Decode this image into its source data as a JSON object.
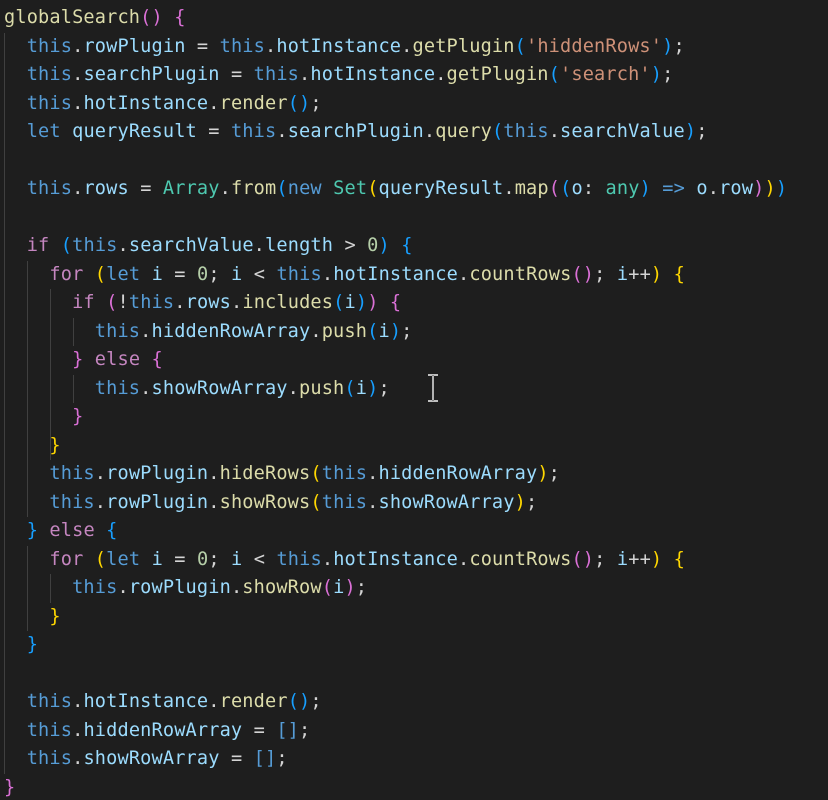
{
  "editor": {
    "colors": {
      "background": "#1e1e1e",
      "keyword": "#569cd6",
      "control": "#c586c0",
      "function": "#dcdcaa",
      "property": "#9cdcfe",
      "string": "#ce9178",
      "number": "#b5cea8",
      "type": "#4ec9b0",
      "bracket1": "#ffd700",
      "bracket2": "#da70d6",
      "bracket3": "#179fff"
    },
    "lines": [
      [
        [
          "fn",
          "globalSearch"
        ],
        [
          "b2",
          "()"
        ],
        [
          "plain",
          " "
        ],
        [
          "b2",
          "{"
        ]
      ],
      [
        [
          "plain",
          "  "
        ],
        [
          "kw",
          "this"
        ],
        [
          "plain",
          "."
        ],
        [
          "var",
          "rowPlugin"
        ],
        [
          "plain",
          " = "
        ],
        [
          "kw",
          "this"
        ],
        [
          "plain",
          "."
        ],
        [
          "var",
          "hotInstance"
        ],
        [
          "plain",
          "."
        ],
        [
          "fn",
          "getPlugin"
        ],
        [
          "b3",
          "("
        ],
        [
          "str",
          "'hiddenRows'"
        ],
        [
          "b3",
          ")"
        ],
        [
          "plain",
          ";"
        ]
      ],
      [
        [
          "plain",
          "  "
        ],
        [
          "kw",
          "this"
        ],
        [
          "plain",
          "."
        ],
        [
          "var",
          "searchPlugin"
        ],
        [
          "plain",
          " = "
        ],
        [
          "kw",
          "this"
        ],
        [
          "plain",
          "."
        ],
        [
          "var",
          "hotInstance"
        ],
        [
          "plain",
          "."
        ],
        [
          "fn",
          "getPlugin"
        ],
        [
          "b3",
          "("
        ],
        [
          "str",
          "'search'"
        ],
        [
          "b3",
          ")"
        ],
        [
          "plain",
          ";"
        ]
      ],
      [
        [
          "plain",
          "  "
        ],
        [
          "kw",
          "this"
        ],
        [
          "plain",
          "."
        ],
        [
          "var",
          "hotInstance"
        ],
        [
          "plain",
          "."
        ],
        [
          "fn",
          "render"
        ],
        [
          "b3",
          "()"
        ],
        [
          "plain",
          ";"
        ]
      ],
      [
        [
          "plain",
          "  "
        ],
        [
          "kw",
          "let"
        ],
        [
          "plain",
          " "
        ],
        [
          "var",
          "queryResult"
        ],
        [
          "plain",
          " = "
        ],
        [
          "kw",
          "this"
        ],
        [
          "plain",
          "."
        ],
        [
          "var",
          "searchPlugin"
        ],
        [
          "plain",
          "."
        ],
        [
          "fn",
          "query"
        ],
        [
          "b3",
          "("
        ],
        [
          "kw",
          "this"
        ],
        [
          "plain",
          "."
        ],
        [
          "var",
          "searchValue"
        ],
        [
          "b3",
          ")"
        ],
        [
          "plain",
          ";"
        ]
      ],
      [
        [
          "plain",
          ""
        ]
      ],
      [
        [
          "plain",
          "  "
        ],
        [
          "kw",
          "this"
        ],
        [
          "plain",
          "."
        ],
        [
          "var",
          "rows"
        ],
        [
          "plain",
          " = "
        ],
        [
          "typ",
          "Array"
        ],
        [
          "plain",
          "."
        ],
        [
          "fn",
          "from"
        ],
        [
          "b3",
          "("
        ],
        [
          "kw",
          "new"
        ],
        [
          "plain",
          " "
        ],
        [
          "typ",
          "Set"
        ],
        [
          "b1",
          "("
        ],
        [
          "var",
          "queryResult"
        ],
        [
          "plain",
          "."
        ],
        [
          "fn",
          "map"
        ],
        [
          "b2",
          "("
        ],
        [
          "b3",
          "("
        ],
        [
          "var",
          "o"
        ],
        [
          "plain",
          ": "
        ],
        [
          "typ",
          "any"
        ],
        [
          "b3",
          ")"
        ],
        [
          "plain",
          " "
        ],
        [
          "kw",
          "=>"
        ],
        [
          "plain",
          " "
        ],
        [
          "var",
          "o"
        ],
        [
          "plain",
          "."
        ],
        [
          "var",
          "row"
        ],
        [
          "b2",
          ")"
        ],
        [
          "b1",
          ")"
        ],
        [
          "b3",
          ")"
        ]
      ],
      [
        [
          "plain",
          ""
        ]
      ],
      [
        [
          "plain",
          "  "
        ],
        [
          "ctl",
          "if"
        ],
        [
          "plain",
          " "
        ],
        [
          "b3",
          "("
        ],
        [
          "kw",
          "this"
        ],
        [
          "plain",
          "."
        ],
        [
          "var",
          "searchValue"
        ],
        [
          "plain",
          "."
        ],
        [
          "var",
          "length"
        ],
        [
          "plain",
          " > "
        ],
        [
          "num",
          "0"
        ],
        [
          "b3",
          ")"
        ],
        [
          "plain",
          " "
        ],
        [
          "b3",
          "{"
        ]
      ],
      [
        [
          "plain",
          "    "
        ],
        [
          "ctl",
          "for"
        ],
        [
          "plain",
          " "
        ],
        [
          "b1",
          "("
        ],
        [
          "kw",
          "let"
        ],
        [
          "plain",
          " "
        ],
        [
          "var",
          "i"
        ],
        [
          "plain",
          " = "
        ],
        [
          "num",
          "0"
        ],
        [
          "plain",
          "; "
        ],
        [
          "var",
          "i"
        ],
        [
          "plain",
          " < "
        ],
        [
          "kw",
          "this"
        ],
        [
          "plain",
          "."
        ],
        [
          "var",
          "hotInstance"
        ],
        [
          "plain",
          "."
        ],
        [
          "fn",
          "countRows"
        ],
        [
          "b2",
          "()"
        ],
        [
          "plain",
          "; "
        ],
        [
          "var",
          "i"
        ],
        [
          "plain",
          "++"
        ],
        [
          "b1",
          ")"
        ],
        [
          "plain",
          " "
        ],
        [
          "b1",
          "{"
        ]
      ],
      [
        [
          "plain",
          "      "
        ],
        [
          "ctl",
          "if"
        ],
        [
          "plain",
          " "
        ],
        [
          "b2",
          "("
        ],
        [
          "plain",
          "!"
        ],
        [
          "kw",
          "this"
        ],
        [
          "plain",
          "."
        ],
        [
          "var",
          "rows"
        ],
        [
          "plain",
          "."
        ],
        [
          "fn",
          "includes"
        ],
        [
          "b3",
          "("
        ],
        [
          "var",
          "i"
        ],
        [
          "b3",
          ")"
        ],
        [
          "b2",
          ")"
        ],
        [
          "plain",
          " "
        ],
        [
          "b2",
          "{"
        ]
      ],
      [
        [
          "plain",
          "        "
        ],
        [
          "kw",
          "this"
        ],
        [
          "plain",
          "."
        ],
        [
          "var",
          "hiddenRowArray"
        ],
        [
          "plain",
          "."
        ],
        [
          "fn",
          "push"
        ],
        [
          "b3",
          "("
        ],
        [
          "var",
          "i"
        ],
        [
          "b3",
          ")"
        ],
        [
          "plain",
          ";"
        ]
      ],
      [
        [
          "plain",
          "      "
        ],
        [
          "b2",
          "}"
        ],
        [
          "plain",
          " "
        ],
        [
          "ctl",
          "else"
        ],
        [
          "plain",
          " "
        ],
        [
          "b2",
          "{"
        ]
      ],
      [
        [
          "plain",
          "        "
        ],
        [
          "kw",
          "this"
        ],
        [
          "plain",
          "."
        ],
        [
          "var",
          "showRowArray"
        ],
        [
          "plain",
          "."
        ],
        [
          "fn",
          "push"
        ],
        [
          "b3",
          "("
        ],
        [
          "var",
          "i"
        ],
        [
          "b3",
          ")"
        ],
        [
          "plain",
          ";"
        ]
      ],
      [
        [
          "plain",
          "      "
        ],
        [
          "b2",
          "}"
        ]
      ],
      [
        [
          "plain",
          "    "
        ],
        [
          "b1",
          "}"
        ]
      ],
      [
        [
          "plain",
          "    "
        ],
        [
          "kw",
          "this"
        ],
        [
          "plain",
          "."
        ],
        [
          "var",
          "rowPlugin"
        ],
        [
          "plain",
          "."
        ],
        [
          "fn",
          "hideRows"
        ],
        [
          "b1",
          "("
        ],
        [
          "kw",
          "this"
        ],
        [
          "plain",
          "."
        ],
        [
          "var",
          "hiddenRowArray"
        ],
        [
          "b1",
          ")"
        ],
        [
          "plain",
          ";"
        ]
      ],
      [
        [
          "plain",
          "    "
        ],
        [
          "kw",
          "this"
        ],
        [
          "plain",
          "."
        ],
        [
          "var",
          "rowPlugin"
        ],
        [
          "plain",
          "."
        ],
        [
          "fn",
          "showRows"
        ],
        [
          "b1",
          "("
        ],
        [
          "kw",
          "this"
        ],
        [
          "plain",
          "."
        ],
        [
          "var",
          "showRowArray"
        ],
        [
          "b1",
          ")"
        ],
        [
          "plain",
          ";"
        ]
      ],
      [
        [
          "plain",
          "  "
        ],
        [
          "b3",
          "}"
        ],
        [
          "plain",
          " "
        ],
        [
          "ctl",
          "else"
        ],
        [
          "plain",
          " "
        ],
        [
          "b3",
          "{"
        ]
      ],
      [
        [
          "plain",
          "    "
        ],
        [
          "ctl",
          "for"
        ],
        [
          "plain",
          " "
        ],
        [
          "b1",
          "("
        ],
        [
          "kw",
          "let"
        ],
        [
          "plain",
          " "
        ],
        [
          "var",
          "i"
        ],
        [
          "plain",
          " = "
        ],
        [
          "num",
          "0"
        ],
        [
          "plain",
          "; "
        ],
        [
          "var",
          "i"
        ],
        [
          "plain",
          " < "
        ],
        [
          "kw",
          "this"
        ],
        [
          "plain",
          "."
        ],
        [
          "var",
          "hotInstance"
        ],
        [
          "plain",
          "."
        ],
        [
          "fn",
          "countRows"
        ],
        [
          "b2",
          "()"
        ],
        [
          "plain",
          "; "
        ],
        [
          "var",
          "i"
        ],
        [
          "plain",
          "++"
        ],
        [
          "b1",
          ")"
        ],
        [
          "plain",
          " "
        ],
        [
          "b1",
          "{"
        ]
      ],
      [
        [
          "plain",
          "      "
        ],
        [
          "kw",
          "this"
        ],
        [
          "plain",
          "."
        ],
        [
          "var",
          "rowPlugin"
        ],
        [
          "plain",
          "."
        ],
        [
          "fn",
          "showRow"
        ],
        [
          "b2",
          "("
        ],
        [
          "var",
          "i"
        ],
        [
          "b2",
          ")"
        ],
        [
          "plain",
          ";"
        ]
      ],
      [
        [
          "plain",
          "    "
        ],
        [
          "b1",
          "}"
        ]
      ],
      [
        [
          "plain",
          "  "
        ],
        [
          "b3",
          "}"
        ]
      ],
      [
        [
          "plain",
          ""
        ]
      ],
      [
        [
          "plain",
          "  "
        ],
        [
          "kw",
          "this"
        ],
        [
          "plain",
          "."
        ],
        [
          "var",
          "hotInstance"
        ],
        [
          "plain",
          "."
        ],
        [
          "fn",
          "render"
        ],
        [
          "b3",
          "()"
        ],
        [
          "plain",
          ";"
        ]
      ],
      [
        [
          "plain",
          "  "
        ],
        [
          "kw",
          "this"
        ],
        [
          "plain",
          "."
        ],
        [
          "var",
          "hiddenRowArray"
        ],
        [
          "plain",
          " = "
        ],
        [
          "kw",
          "[]"
        ],
        [
          "plain",
          ";"
        ]
      ],
      [
        [
          "plain",
          "  "
        ],
        [
          "kw",
          "this"
        ],
        [
          "plain",
          "."
        ],
        [
          "var",
          "showRowArray"
        ],
        [
          "plain",
          " = "
        ],
        [
          "kw",
          "[]"
        ],
        [
          "plain",
          ";"
        ]
      ],
      [
        [
          "b2",
          "}"
        ]
      ]
    ]
  }
}
